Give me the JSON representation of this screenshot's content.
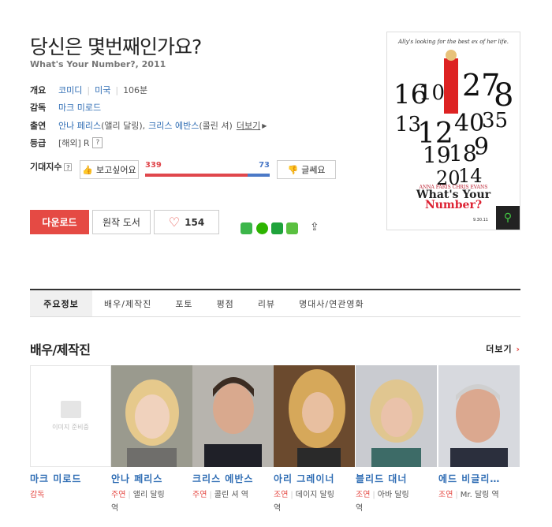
{
  "movie": {
    "title": "당신은 몇번째인가요?",
    "subtitle": "What's Your Number?, 2011"
  },
  "info": {
    "overview_label": "개요",
    "genre": "코미디",
    "country": "미국",
    "runtime": "106분",
    "director_label": "감독",
    "director": "마크 미로드",
    "cast_label": "출연",
    "cast_1": "안나 페리스",
    "cast_1_role": "(앨리 달링),",
    "cast_2": "크리스 에반스",
    "cast_2_role": "(콜린 셔)",
    "more_cast": "더보기",
    "rating_label": "등급",
    "rating_region": "[해외]",
    "rating": "R"
  },
  "expectation": {
    "label": "기대지수",
    "want_label": "보고싶어요",
    "doubt_label": "글쎄요",
    "want_count": "339",
    "doubt_count": "73",
    "want_fraction": 0.82
  },
  "actions": {
    "download": "다운로드",
    "original_book": "원작 도서",
    "likes": "154"
  },
  "poster": {
    "tagline": "Ally's looking for the best ex of her life.",
    "names": "ANNA FARIS    CHRIS EVANS",
    "title_line1": "What's Your",
    "title_line2": "Number?",
    "date": "9.30.11"
  },
  "tabs": [
    "주요정보",
    "배우/제작진",
    "포토",
    "평점",
    "리뷰",
    "명대사/연관영화"
  ],
  "cast_section": {
    "title": "배우/제작진",
    "more": "더보기",
    "placeholder_text": "이미지 준비중",
    "people": [
      {
        "name": "마크 미로드",
        "type": "감독",
        "role": "",
        "role2": ""
      },
      {
        "name": "안나 페리스",
        "type": "주연",
        "role": "앨리 달링",
        "role2": "역"
      },
      {
        "name": "크리스 에반스",
        "type": "주연",
        "role": "콜린 셔 역",
        "role2": ""
      },
      {
        "name": "아리 그레이너",
        "type": "조연",
        "role": "데이지 달링",
        "role2": "역"
      },
      {
        "name": "블리드 대너",
        "type": "조연",
        "role": "아바 달링",
        "role2": "역"
      },
      {
        "name": "에드 비글리…",
        "type": "조연",
        "role": "Mr. 달링 역",
        "role2": ""
      }
    ]
  }
}
